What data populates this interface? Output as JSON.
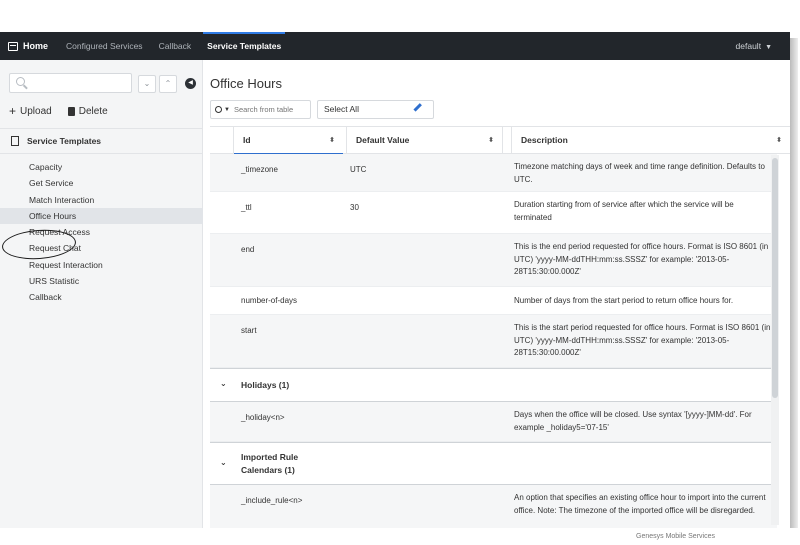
{
  "topbar": {
    "home": "Home",
    "links": [
      "Configured Services",
      "Callback",
      "Service Templates"
    ],
    "user": "default"
  },
  "sidebar": {
    "search_placeholder": "",
    "upload": "Upload",
    "delete": "Delete",
    "section": "Service Templates",
    "items": [
      "Capacity",
      "Get Service",
      "Match Interaction",
      "Office Hours",
      "Request Access",
      "Request Chat",
      "Request Interaction",
      "URS Statistic",
      "Callback"
    ],
    "selected": "Office Hours"
  },
  "main": {
    "title": "Office Hours",
    "search_placeholder": "Search from table",
    "select_label": "Select All",
    "columns": [
      "Id",
      "Default Value",
      "Description"
    ],
    "rows": [
      {
        "id": "_timezone",
        "value": "UTC",
        "desc": "Timezone matching days of week and time range definition. Defaults to UTC."
      },
      {
        "id": "_ttl",
        "value": "30",
        "desc": "Duration starting from of service after which the service will be terminated"
      },
      {
        "id": "end",
        "value": "",
        "desc": "This is the end period requested for office hours. Format is ISO 8601 (in UTC) 'yyyy-MM-ddTHH:mm:ss.SSSZ' for example: '2013-05-28T15:30:00.000Z'"
      },
      {
        "id": "number-of-days",
        "value": "",
        "desc": "Number of days from the start period to return office hours for."
      },
      {
        "id": "start",
        "value": "",
        "desc": "This is the start period requested for office hours. Format is ISO 8601 (in UTC) 'yyyy-MM-ddTHH:mm:ss.SSSZ' for example: '2013-05-28T15:30:00.000Z'"
      }
    ],
    "group1": "Holidays (1)",
    "group1_row": {
      "id": "_holiday<n>",
      "value": "",
      "desc": "Days when the office will be closed. Use syntax '[yyyy-]MM-dd'. For example _holiday5='07-15'"
    },
    "group2": "Imported Rule Calendars (1)",
    "group2_row": {
      "id": "_include_rule<n>",
      "value": "",
      "desc": "An option that specifies an existing office hour to import into the current office. Note: The timezone of the imported office will be disregarded."
    }
  },
  "watermark": "Genesys Mobile Services"
}
